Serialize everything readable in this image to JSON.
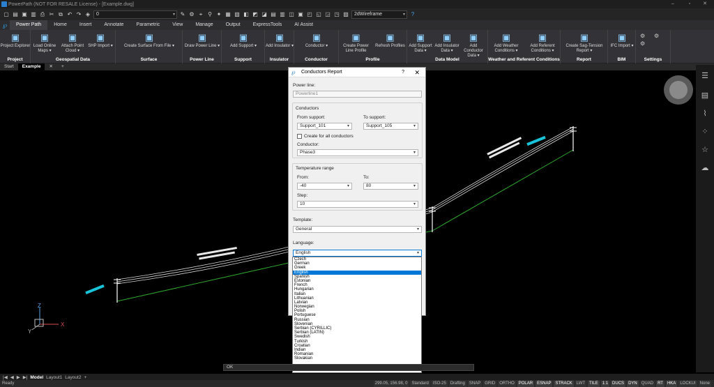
{
  "app": {
    "title": "PowerPath (NOT FOR RESALE License) - [Example.dwg]"
  },
  "qat": {
    "layer_value": "0",
    "visual_style": "2dWireframe"
  },
  "ribbon_tabs": [
    "Power Path",
    "Home",
    "Insert",
    "Annotate",
    "Parametric",
    "View",
    "Manage",
    "Output",
    "ExpressTools",
    "AI Assist"
  ],
  "ribbon_groups": [
    {
      "label": "Project",
      "buttons": [
        {
          "label": "Project Explorer",
          "icon": "project-explorer-icon"
        }
      ]
    },
    {
      "label": "Geospatial Data",
      "buttons": [
        {
          "label": "Load Online Maps ▾",
          "icon": "map-icon"
        },
        {
          "label": "Attach Point Cloud ▾",
          "icon": "point-cloud-icon"
        },
        {
          "label": "SHP Import ▾",
          "icon": "shp-import-icon"
        }
      ]
    },
    {
      "label": "Surface",
      "buttons": [
        {
          "label": "Create Surface From File ▾",
          "icon": "surface-icon"
        }
      ]
    },
    {
      "label": "Power Line",
      "buttons": [
        {
          "label": "Draw Power Line ▾",
          "icon": "power-line-icon"
        }
      ]
    },
    {
      "label": "Support",
      "buttons": [
        {
          "label": "Add Support ▾",
          "icon": "support-icon"
        }
      ]
    },
    {
      "label": "Insulator",
      "buttons": [
        {
          "label": "Add Insulator ▾",
          "icon": "insulator-icon"
        }
      ]
    },
    {
      "label": "Conductor",
      "buttons": [
        {
          "label": "Conductor ▾",
          "icon": "conductor-icon"
        }
      ]
    },
    {
      "label": "Profile",
      "buttons": [
        {
          "label": "Create Power Line Profile",
          "icon": "profile-icon"
        },
        {
          "label": "Refresh Profiles",
          "icon": "refresh-profiles-icon"
        }
      ]
    },
    {
      "label": "Data Model",
      "buttons": [
        {
          "label": "Add Support Data ▾",
          "icon": "support-data-icon"
        },
        {
          "label": "Add Insulator Data ▾",
          "icon": "insulator-data-icon"
        },
        {
          "label": "Add Conductor Data ▾",
          "icon": "conductor-data-icon"
        }
      ]
    },
    {
      "label": "Weather and Referent Conditions",
      "buttons": [
        {
          "label": "Add Weather Conditions ▾",
          "icon": "weather-icon"
        },
        {
          "label": "Add Referent Conditions ▾",
          "icon": "referent-icon"
        }
      ]
    },
    {
      "label": "Report",
      "buttons": [
        {
          "label": "Create Sag-Tension Report ▾",
          "icon": "report-icon"
        }
      ]
    },
    {
      "label": "BIM",
      "buttons": [
        {
          "label": "IFC Import ▾",
          "icon": "ifc-icon"
        }
      ]
    },
    {
      "label": "Settings",
      "buttons": []
    }
  ],
  "doc_tabs": [
    "Start",
    "Example"
  ],
  "dialog": {
    "title": "Conductors Report",
    "power_line_label": "Power line:",
    "power_line_value": "Powerline1",
    "conductors_label": "Conductors",
    "from_support_label": "From support:",
    "from_support_value": "Support_101",
    "to_support_label": "To support:",
    "to_support_value": "Support_105",
    "all_conductors_label": "Create for all conductors",
    "conductor_label": "Conductor:",
    "conductor_value": "Phase3",
    "temp_label": "Temperature range",
    "from_label": "From:",
    "from_value": "-40",
    "to_label": "To:",
    "to_value": "80",
    "step_label": "Step:",
    "step_value": "10",
    "template_label": "Template:",
    "template_value": "General",
    "language_label": "Language:",
    "language_value": "English",
    "languages": [
      "Czech",
      "German",
      "Greek",
      "English",
      "Spanish",
      "Estonian",
      "French",
      "Hungarian",
      "Italian",
      "Lithuanian",
      "Latvian",
      "Norwegian",
      "Polish",
      "Portuguese",
      "Russian",
      "Slovenian",
      "Serbian (CYRILLIC)",
      "Serbian (LATIN)",
      "Swedish",
      "Turkish",
      "Croatian",
      "Indian",
      "Romanian",
      "Slovakian"
    ],
    "selected_language": "English"
  },
  "command_line": {
    "text": "OK"
  },
  "layout_tabs": [
    "Model",
    "Layout1",
    "Layout2"
  ],
  "status": {
    "ready": "Ready",
    "coords": "299.05, 156.98, 0",
    "style": "Standard",
    "iso": "ISO-25",
    "workspace": "Drafting",
    "toggles": [
      "SNAP",
      "GRID",
      "ORTHO",
      "POLAR",
      "ESNAP",
      "STRACK",
      "LWT",
      "TILE",
      "1:1",
      "DUCS",
      "DYN",
      "QUAD",
      "RT",
      "HKA",
      "LOCKUI",
      "None"
    ]
  },
  "colors": {
    "accent": "#0078d7",
    "conductor_green": "#2fa62f",
    "label_cyan": "#19c3d8"
  }
}
